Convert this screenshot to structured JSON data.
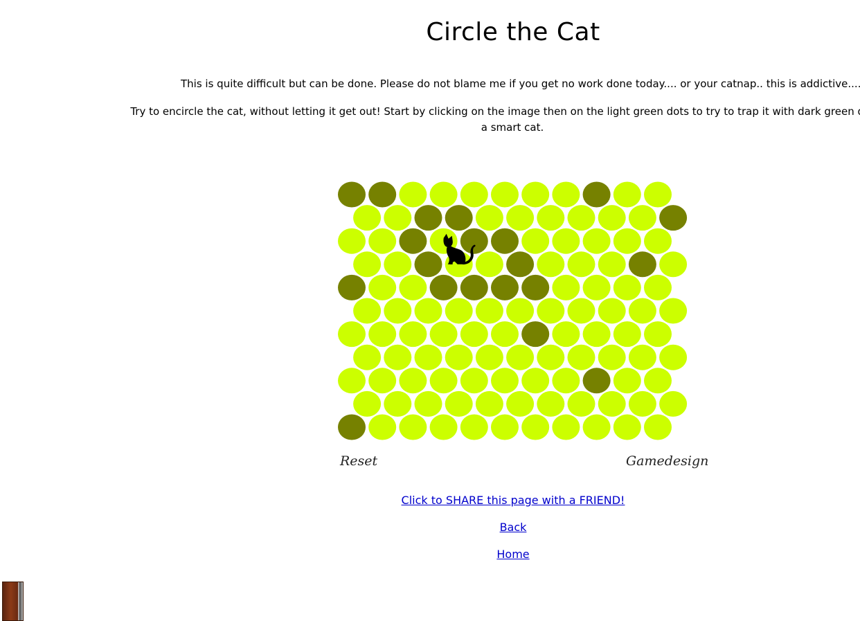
{
  "page": {
    "title": "Circle the Cat",
    "intro": "This is quite difficult but can be done. Please  do not blame me if you get no work done today.... or  your catnap.. this is addictive....",
    "instructions_line1": "Try to encircle the cat, without letting it get out! Start by clicking on the image then on the light green dots to try to trap it with dark green dots. N",
    "instructions_line2": "a smart cat."
  },
  "game": {
    "rows": 11,
    "cols": 11,
    "colors": {
      "light": "#ccff00",
      "dark": "#768100",
      "cat": "#000000"
    },
    "blocked": [
      [
        0,
        0
      ],
      [
        0,
        1
      ],
      [
        0,
        8
      ],
      [
        1,
        2
      ],
      [
        1,
        3
      ],
      [
        1,
        10
      ],
      [
        2,
        2
      ],
      [
        2,
        4
      ],
      [
        2,
        5
      ],
      [
        3,
        2
      ],
      [
        3,
        5
      ],
      [
        3,
        9
      ],
      [
        4,
        0
      ],
      [
        4,
        3
      ],
      [
        4,
        4
      ],
      [
        4,
        5
      ],
      [
        4,
        6
      ],
      [
        6,
        6
      ],
      [
        8,
        8
      ],
      [
        10,
        0
      ]
    ],
    "cat_cell": [
      3,
      3
    ],
    "reset_label": "Reset",
    "gamedesign_label": "Gamedesign"
  },
  "links": {
    "share": "Click to SHARE this page with a FRIEND!",
    "back": "Back",
    "home": "Home"
  }
}
